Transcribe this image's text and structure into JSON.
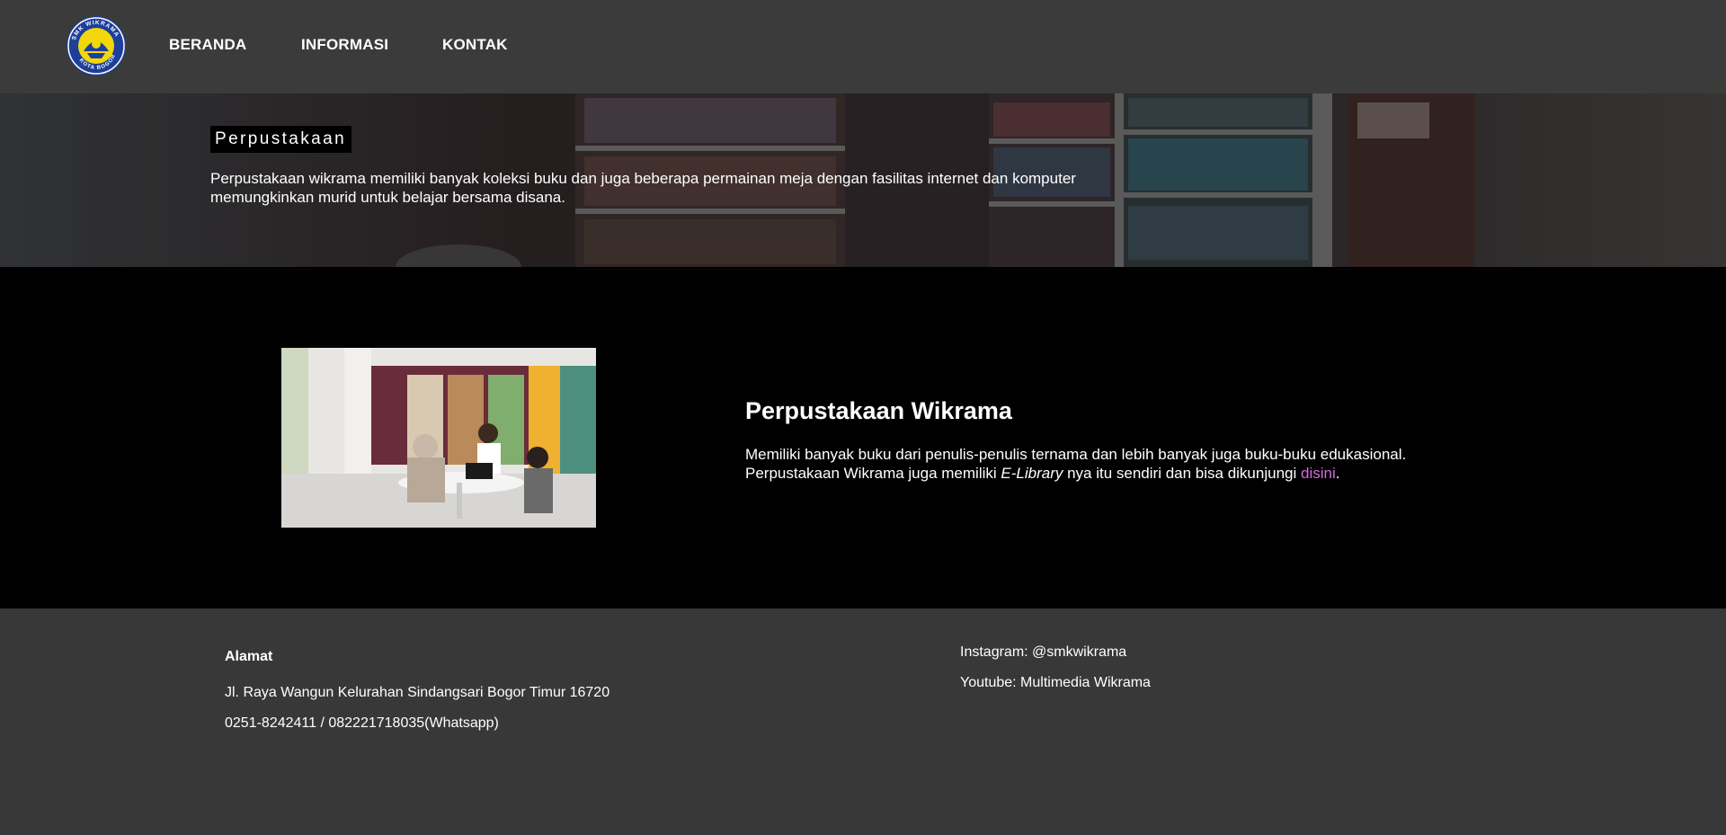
{
  "nav": {
    "logo_text": "SMK WIKRAMA KOTA BOGOR",
    "items": [
      {
        "label": "BERANDA"
      },
      {
        "label": "INFORMASI"
      },
      {
        "label": "KONTAK"
      }
    ]
  },
  "hero": {
    "title": "Perpustakaan",
    "description": "Perpustakaan wikrama memiliki banyak koleksi buku dan juga beberapa permainan meja dengan fasilitas internet dan komputer memungkinkan murid untuk belajar bersama disana."
  },
  "main": {
    "title": "Perpustakaan Wikrama",
    "text_line1": "Memiliki banyak buku dari penulis-penulis ternama dan lebih banyak juga buku-buku edukasional.",
    "text_line2_before": "Perpustakaan Wikrama juga memiliki ",
    "text_line2_em": "E-Library",
    "text_line2_middle": " nya itu sendiri dan bisa dikunjungi ",
    "link_label": "disini",
    "text_line2_after": "."
  },
  "footer": {
    "heading": "Alamat",
    "address": "Jl. Raya Wangun Kelurahan Sindangsari Bogor Timur 16720",
    "phone": "0251-8242411 / 082221718035(Whatsapp)",
    "instagram": "Instagram: @smkwikrama",
    "youtube": "Youtube: Multimedia Wikrama"
  },
  "colors": {
    "nav_bg": "#3b3b3b",
    "main_bg": "#000000",
    "footer_bg": "#383838",
    "link": "#d66bdc"
  }
}
